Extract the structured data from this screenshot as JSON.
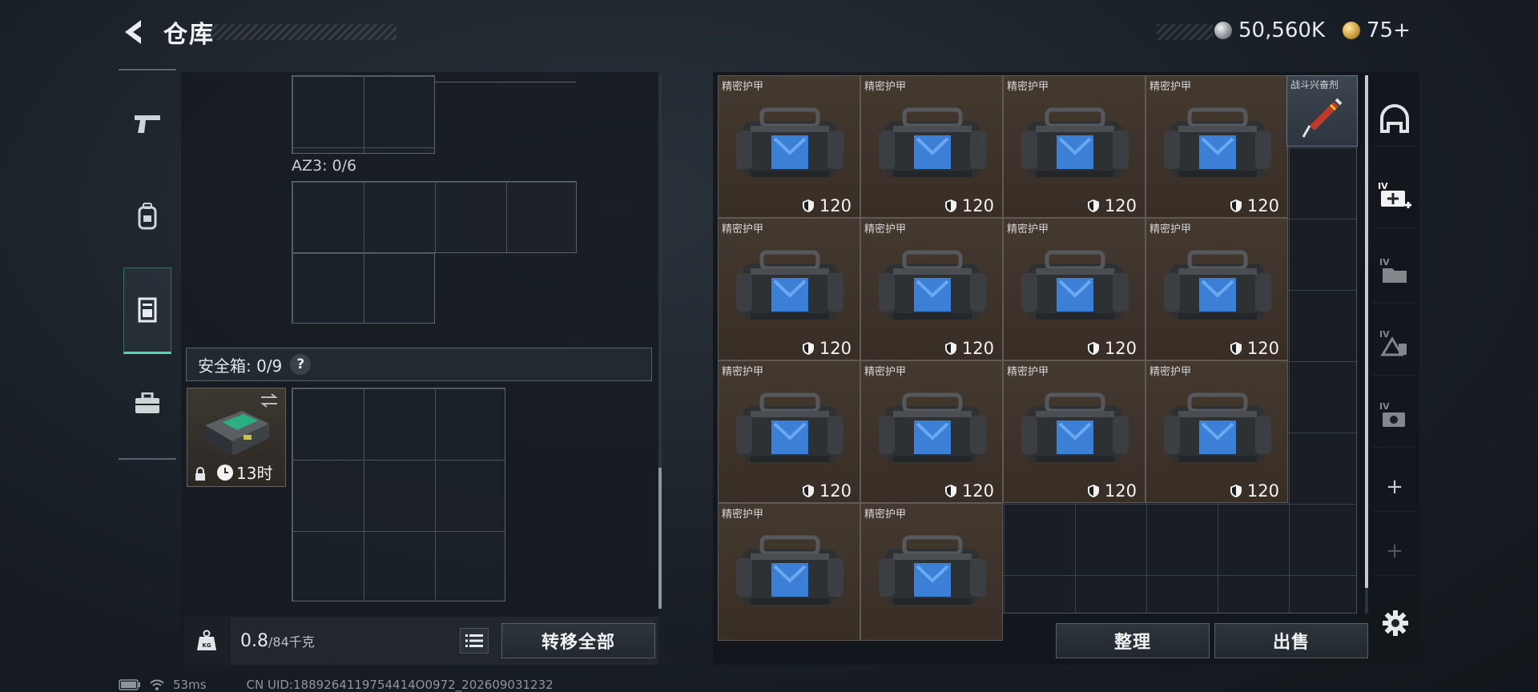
{
  "header": {
    "title": "仓库"
  },
  "currencies": [
    {
      "name": "silver-coin",
      "amount": "50,560K"
    },
    {
      "name": "gold-coin",
      "amount": "75+"
    }
  ],
  "left_sidebar": {
    "tabs": [
      {
        "icon": "pistol-icon",
        "active": false
      },
      {
        "icon": "backpack-icon",
        "active": false
      },
      {
        "icon": "vest-icon",
        "active": true
      },
      {
        "icon": "briefcase-icon",
        "active": false
      }
    ]
  },
  "container": {
    "az3_label": "AZ3: 0/6"
  },
  "safebox": {
    "label": "安全箱: 0/9",
    "help": "?",
    "time_left": "13时"
  },
  "weight": {
    "current": "0.8",
    "max": "/84千克"
  },
  "buttons": {
    "transfer_all": "转移全部",
    "sort": "整理",
    "sell": "出售"
  },
  "stash": {
    "armor_items": [
      {
        "name": "精密护甲",
        "durability": "120"
      },
      {
        "name": "精密护甲",
        "durability": "120"
      },
      {
        "name": "精密护甲",
        "durability": "120"
      },
      {
        "name": "精密护甲",
        "durability": "120"
      },
      {
        "name": "精密护甲",
        "durability": "120"
      },
      {
        "name": "精密护甲",
        "durability": "120"
      },
      {
        "name": "精密护甲",
        "durability": "120"
      },
      {
        "name": "精密护甲",
        "durability": "120"
      },
      {
        "name": "精密护甲",
        "durability": "120"
      },
      {
        "name": "精密护甲",
        "durability": "120"
      },
      {
        "name": "精密护甲",
        "durability": "120"
      },
      {
        "name": "精密护甲",
        "durability": "120"
      },
      {
        "name": "精密护甲",
        "durability": ""
      },
      {
        "name": "精密护甲",
        "durability": ""
      }
    ],
    "stim_item": {
      "name": "战斗兴奋剂"
    }
  },
  "right_sidebar": {
    "items": [
      {
        "icon": "helmet-icon",
        "label": ""
      },
      {
        "icon": "add-stash-icon",
        "label": "IV"
      },
      {
        "icon": "stash-page-icon",
        "label": "IV"
      },
      {
        "icon": "stash-page-icon",
        "label": "IV"
      },
      {
        "icon": "stash-page-icon",
        "label": "IV"
      },
      {
        "icon": "plus-icon",
        "label": "+"
      },
      {
        "icon": "plus-icon",
        "label": "+"
      }
    ]
  },
  "status": {
    "ping": "53ms",
    "uid": "CN UID:1889264119754414O0972_202609031232"
  },
  "colors": {
    "accent": "#4fd9b0",
    "armor_cell_bg": "#3e342b",
    "panel_bg": "#161b21"
  }
}
